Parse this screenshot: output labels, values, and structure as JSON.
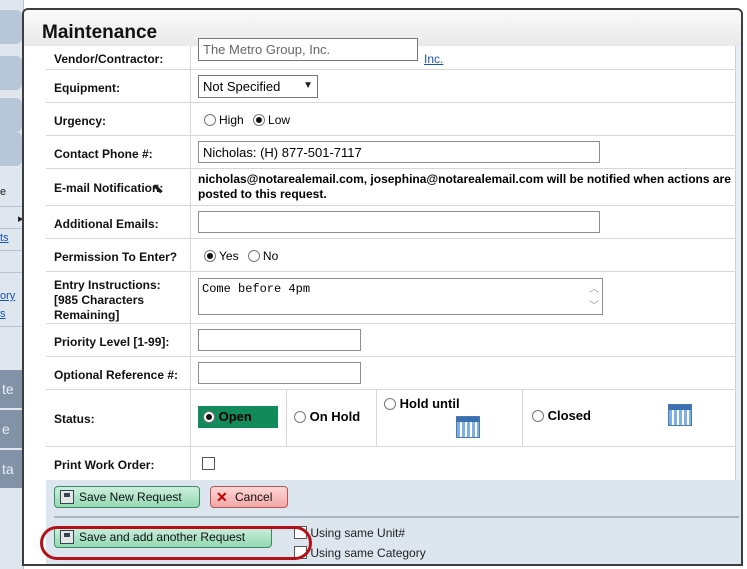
{
  "dialog": {
    "title": "Maintenance"
  },
  "background": {
    "left_text": "e",
    "link1": "ts",
    "link2": "ory",
    "link3": "s",
    "dark1": "te",
    "dark2": "e",
    "dark3": "ta"
  },
  "form": {
    "vendor": {
      "label": "Vendor/Contractor:",
      "value": "The Metro Group, Inc.",
      "link": "Inc."
    },
    "equipment": {
      "label": "Equipment:",
      "value": "Not Specified"
    },
    "urgency": {
      "label": "Urgency:",
      "options": [
        "High",
        "Low"
      ],
      "selected": "Low"
    },
    "contact_phone": {
      "label": "Contact Phone #:",
      "value": "Nicholas: (H) 877-501-7117"
    },
    "email_notification": {
      "label": "E-mail Notification:",
      "text": "nicholas@notarealemail.com, josephina@notarealemail.com will be notified when actions are posted to this request."
    },
    "additional_emails": {
      "label": "Additional Emails:",
      "value": ""
    },
    "permission": {
      "label": "Permission To Enter?",
      "options": [
        "Yes",
        "No"
      ],
      "selected": "Yes"
    },
    "entry_instructions": {
      "label": "Entry Instructions:",
      "sub": "[985 Characters Remaining]",
      "value": "Come before 4pm"
    },
    "priority": {
      "label": "Priority Level [1-99]:",
      "value": ""
    },
    "reference": {
      "label": "Optional Reference #:",
      "value": ""
    },
    "status": {
      "label": "Status:",
      "options": [
        "Open",
        "On Hold",
        "Hold until",
        "Closed"
      ],
      "selected": "Open"
    },
    "print_work_order": {
      "label": "Print Work Order:",
      "checked": false
    }
  },
  "buttons": {
    "save": "Save New Request",
    "cancel": "Cancel",
    "save_another": "Save and add another Request"
  },
  "checkboxes": {
    "same_unit": "Using same Unit#",
    "same_category": "Using same Category"
  },
  "colors": {
    "status_open_bg": "#128a5c",
    "highlight": "#b31018",
    "button_area": "#dde6ee"
  }
}
